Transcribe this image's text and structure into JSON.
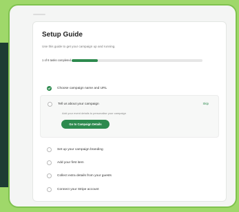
{
  "guide": {
    "title": "Setup Guide",
    "subtitle": "Use this guide to get your campaign up and running.",
    "progress_label": "1 of 6 tasks completed",
    "progress_fraction": 0.2
  },
  "tasks": [
    {
      "label": "Choose campaign name and URL",
      "status": "done"
    },
    {
      "label": "Tell us about your campaign",
      "status": "active",
      "description": "Add your event details to personalise your campaign",
      "skip_label": "Skip",
      "cta_label": "Go to Campaign Details"
    },
    {
      "label": "Set up your campaign branding",
      "status": "todo"
    },
    {
      "label": "Add your first item",
      "status": "todo"
    },
    {
      "label": "Collect extra details from your guests",
      "status": "todo"
    },
    {
      "label": "Connect your Stripe account",
      "status": "todo"
    }
  ],
  "colors": {
    "accent": "#2d8a4e",
    "background": "#9fd86a",
    "frame_border": "#7fc24e",
    "dark_band": "#1d3c33"
  }
}
